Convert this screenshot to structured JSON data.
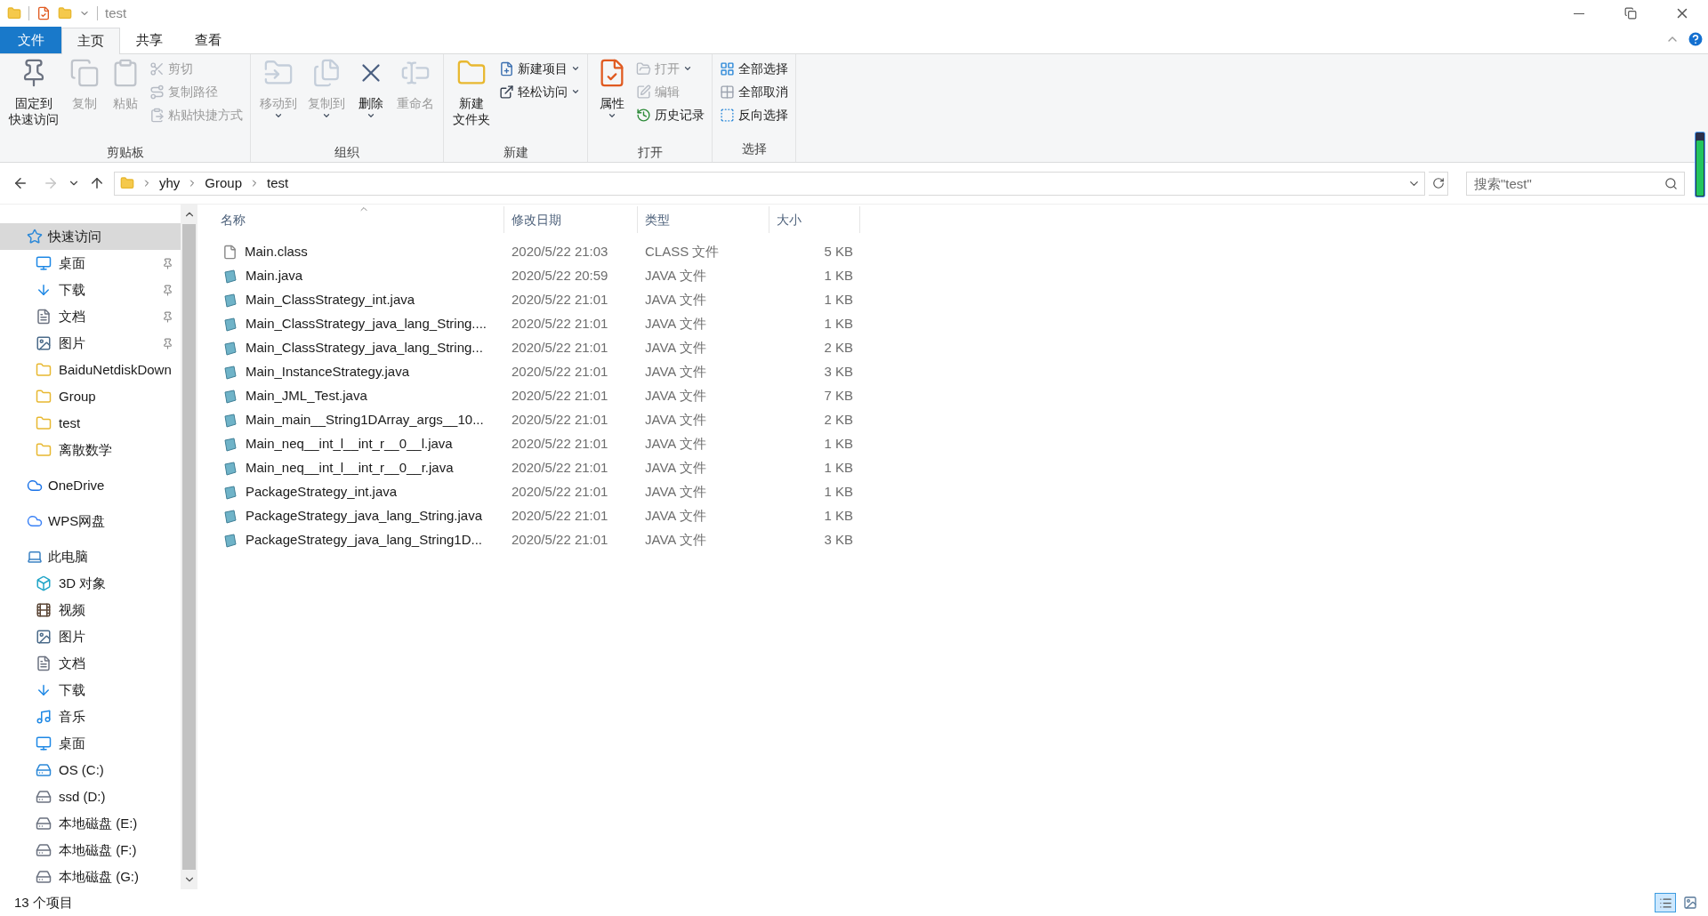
{
  "title_bar": {
    "title": "test"
  },
  "ribbon_tabs": [
    {
      "label": "文件",
      "kind": "file",
      "selected": false
    },
    {
      "label": "主页",
      "kind": "tab",
      "selected": true
    },
    {
      "label": "共享",
      "kind": "tab",
      "selected": false
    },
    {
      "label": "查看",
      "kind": "tab",
      "selected": false
    }
  ],
  "ribbon_groups": [
    {
      "label": "剪贴板",
      "commands": [
        {
          "lines": [
            "固定到",
            "快速访问"
          ],
          "kind": "large",
          "disabled": false,
          "dropdown": false
        },
        {
          "lines": [
            "复制"
          ],
          "kind": "large",
          "disabled": true,
          "dropdown": false
        },
        {
          "lines": [
            "粘贴"
          ],
          "kind": "large",
          "disabled": true,
          "dropdown": false
        },
        {
          "lines": [
            "剪切"
          ],
          "kind": "small",
          "disabled": true,
          "dropdown": false
        },
        {
          "lines": [
            "复制路径"
          ],
          "kind": "small",
          "disabled": true,
          "dropdown": false
        },
        {
          "lines": [
            "粘贴快捷方式"
          ],
          "kind": "small",
          "disabled": true,
          "dropdown": false
        }
      ]
    },
    {
      "label": "组织",
      "commands": [
        {
          "lines": [
            "移动到"
          ],
          "kind": "large",
          "disabled": true,
          "dropdown": true
        },
        {
          "lines": [
            "复制到"
          ],
          "kind": "large",
          "disabled": true,
          "dropdown": true
        },
        {
          "lines": [
            "删除"
          ],
          "kind": "large",
          "disabled": false,
          "dropdown": true
        },
        {
          "lines": [
            "重命名"
          ],
          "kind": "large",
          "disabled": true,
          "dropdown": false
        }
      ]
    },
    {
      "label": "新建",
      "commands": [
        {
          "lines": [
            "新建",
            "文件夹"
          ],
          "kind": "large",
          "disabled": false,
          "dropdown": false
        },
        {
          "lines": [
            "新建项目"
          ],
          "kind": "small",
          "disabled": false,
          "dropdown": true
        },
        {
          "lines": [
            "轻松访问"
          ],
          "kind": "small",
          "disabled": false,
          "dropdown": true
        }
      ]
    },
    {
      "label": "打开",
      "commands": [
        {
          "lines": [
            "属性"
          ],
          "kind": "large",
          "disabled": false,
          "dropdown": true
        },
        {
          "lines": [
            "打开"
          ],
          "kind": "small",
          "disabled": true,
          "dropdown": true
        },
        {
          "lines": [
            "编辑"
          ],
          "kind": "small",
          "disabled": true,
          "dropdown": false
        },
        {
          "lines": [
            "历史记录"
          ],
          "kind": "small",
          "disabled": false,
          "dropdown": false
        }
      ]
    },
    {
      "label": "选择",
      "commands": [
        {
          "lines": [
            "全部选择"
          ],
          "kind": "small",
          "disabled": false,
          "dropdown": false
        },
        {
          "lines": [
            "全部取消"
          ],
          "kind": "small",
          "disabled": false,
          "dropdown": false
        },
        {
          "lines": [
            "反向选择"
          ],
          "kind": "small",
          "disabled": false,
          "dropdown": false
        }
      ]
    }
  ],
  "address_bar": {
    "breadcrumbs": [
      "yhy",
      "Group",
      "test"
    ],
    "search_placeholder": "搜索\"test\""
  },
  "nav_pane": [
    {
      "label": "快速访问",
      "selected": true,
      "children": [
        {
          "label": "桌面",
          "pinned": true,
          "selected": false
        },
        {
          "label": "下载",
          "pinned": true,
          "selected": false
        },
        {
          "label": "文档",
          "pinned": true,
          "selected": false
        },
        {
          "label": "图片",
          "pinned": true,
          "selected": false
        },
        {
          "label": "BaiduNetdiskDown",
          "pinned": false,
          "selected": false
        },
        {
          "label": "Group",
          "pinned": false,
          "selected": false
        },
        {
          "label": "test",
          "pinned": false,
          "selected": false
        },
        {
          "label": "离散数学",
          "pinned": false,
          "selected": false
        }
      ]
    },
    {
      "label": "OneDrive",
      "selected": false
    },
    {
      "label": "WPS网盘",
      "selected": false
    },
    {
      "label": "此电脑",
      "selected": false,
      "children": [
        {
          "label": "3D 对象",
          "pinned": false,
          "selected": false
        },
        {
          "label": "视频",
          "pinned": false,
          "selected": false
        },
        {
          "label": "图片",
          "pinned": false,
          "selected": false
        },
        {
          "label": "文档",
          "pinned": false,
          "selected": false
        },
        {
          "label": "下载",
          "pinned": false,
          "selected": false
        },
        {
          "label": "音乐",
          "pinned": false,
          "selected": false
        },
        {
          "label": "桌面",
          "pinned": false,
          "selected": false
        },
        {
          "label": "OS (C:)",
          "pinned": false,
          "selected": false
        },
        {
          "label": "ssd (D:)",
          "pinned": false,
          "selected": false
        },
        {
          "label": "本地磁盘 (E:)",
          "pinned": false,
          "selected": false
        },
        {
          "label": "本地磁盘 (F:)",
          "pinned": false,
          "selected": false
        },
        {
          "label": "本地磁盘 (G:)",
          "pinned": false,
          "selected": false
        }
      ]
    }
  ],
  "file_list": {
    "columns": [
      {
        "label": "名称",
        "sorted": true
      },
      {
        "label": "修改日期",
        "sorted": false
      },
      {
        "label": "类型",
        "sorted": false
      },
      {
        "label": "大小",
        "sorted": false
      }
    ],
    "rows": [
      {
        "name": "Main.class",
        "modified": "2020/5/22 21:03",
        "type": "CLASS 文件",
        "size": "5 KB",
        "kind": "class"
      },
      {
        "name": "Main.java",
        "modified": "2020/5/22 20:59",
        "type": "JAVA 文件",
        "size": "1 KB",
        "kind": "java"
      },
      {
        "name": "Main_ClassStrategy_int.java",
        "modified": "2020/5/22 21:01",
        "type": "JAVA 文件",
        "size": "1 KB",
        "kind": "java"
      },
      {
        "name": "Main_ClassStrategy_java_lang_String....",
        "modified": "2020/5/22 21:01",
        "type": "JAVA 文件",
        "size": "1 KB",
        "kind": "java"
      },
      {
        "name": "Main_ClassStrategy_java_lang_String...",
        "modified": "2020/5/22 21:01",
        "type": "JAVA 文件",
        "size": "2 KB",
        "kind": "java"
      },
      {
        "name": "Main_InstanceStrategy.java",
        "modified": "2020/5/22 21:01",
        "type": "JAVA 文件",
        "size": "3 KB",
        "kind": "java"
      },
      {
        "name": "Main_JML_Test.java",
        "modified": "2020/5/22 21:01",
        "type": "JAVA 文件",
        "size": "7 KB",
        "kind": "java"
      },
      {
        "name": "Main_main__String1DArray_args__10...",
        "modified": "2020/5/22 21:01",
        "type": "JAVA 文件",
        "size": "2 KB",
        "kind": "java"
      },
      {
        "name": "Main_neq__int_l__int_r__0__l.java",
        "modified": "2020/5/22 21:01",
        "type": "JAVA 文件",
        "size": "1 KB",
        "kind": "java"
      },
      {
        "name": "Main_neq__int_l__int_r__0__r.java",
        "modified": "2020/5/22 21:01",
        "type": "JAVA 文件",
        "size": "1 KB",
        "kind": "java"
      },
      {
        "name": "PackageStrategy_int.java",
        "modified": "2020/5/22 21:01",
        "type": "JAVA 文件",
        "size": "1 KB",
        "kind": "java"
      },
      {
        "name": "PackageStrategy_java_lang_String.java",
        "modified": "2020/5/22 21:01",
        "type": "JAVA 文件",
        "size": "1 KB",
        "kind": "java"
      },
      {
        "name": "PackageStrategy_java_lang_String1D...",
        "modified": "2020/5/22 21:01",
        "type": "JAVA 文件",
        "size": "3 KB",
        "kind": "java"
      }
    ]
  },
  "status_bar": {
    "item_count": "13 个项目",
    "views": [
      {
        "kind": "details",
        "selected": true
      },
      {
        "kind": "large_icons",
        "selected": false
      }
    ]
  }
}
